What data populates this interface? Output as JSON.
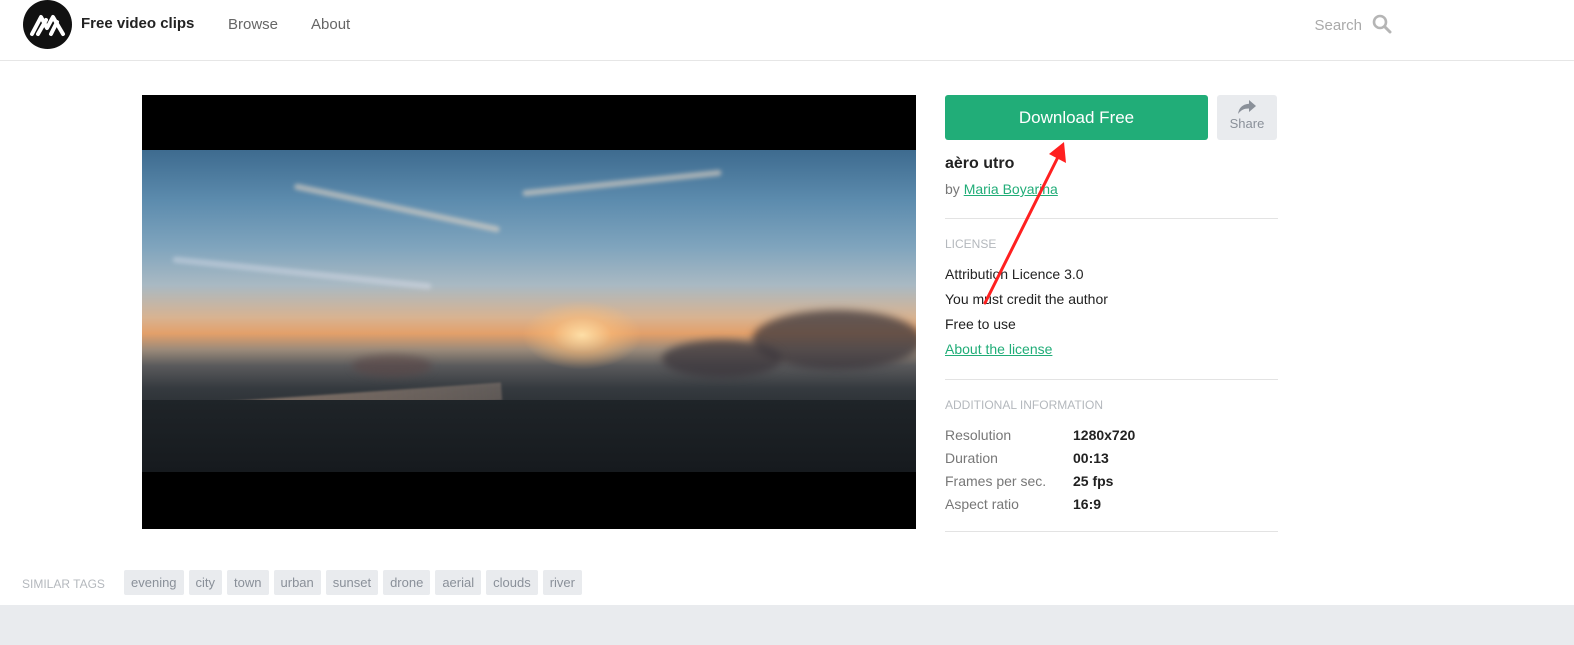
{
  "header": {
    "brand": "Free video clips",
    "nav": [
      {
        "label": "Browse"
      },
      {
        "label": "About"
      }
    ],
    "search_placeholder": "Search",
    "icons": {
      "logo": "mixkit-m-logo",
      "search": "search-icon"
    }
  },
  "clip": {
    "title": "aèro utro",
    "by_prefix": "by",
    "author": "Maria Boyarina"
  },
  "actions": {
    "download_label": "Download Free",
    "share_label": "Share",
    "share_icon": "share-arrow-icon"
  },
  "license": {
    "heading": "LICENSE",
    "lines": [
      "Attribution Licence 3.0",
      "You must credit the author",
      "Free to use"
    ],
    "link": "About the license"
  },
  "info": {
    "heading": "ADDITIONAL INFORMATION",
    "rows": [
      {
        "key": "Resolution",
        "value": "1280x720"
      },
      {
        "key": "Duration",
        "value": "00:13"
      },
      {
        "key": "Frames per sec.",
        "value": "25 fps"
      },
      {
        "key": "Aspect ratio",
        "value": "16:9"
      }
    ]
  },
  "tags": {
    "heading": "SIMILAR TAGS",
    "items": [
      "evening",
      "city",
      "town",
      "urban",
      "sunset",
      "drone",
      "aerial",
      "clouds",
      "river"
    ]
  },
  "colors": {
    "accent": "#21ad78",
    "annotation_arrow": "#ff2020",
    "tag_bg": "#e9ebee"
  }
}
